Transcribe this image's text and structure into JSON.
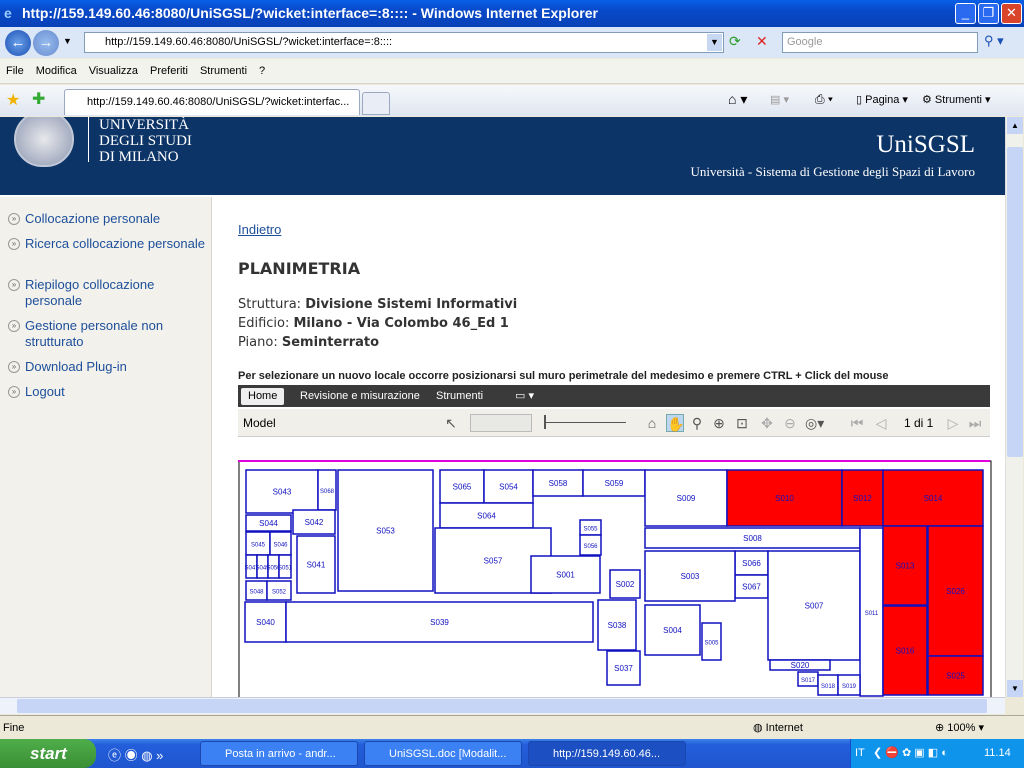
{
  "window": {
    "title": "http://159.149.60.46:8080/UniSGSL/?wicket:interface=:8:::: - Windows Internet Explorer"
  },
  "browser": {
    "address": "http://159.149.60.46:8080/UniSGSL/?wicket:interface=:8::::",
    "search_placeholder": "Google",
    "menu": [
      "File",
      "Modifica",
      "Visualizza",
      "Preferiti",
      "Strumenti",
      "?"
    ],
    "tab_title": "http://159.149.60.46:8080/UniSGSL/?wicket:interfac...",
    "cmd_pagina": "Pagina",
    "cmd_strumenti": "Strumenti",
    "status": "Fine",
    "zone": "Internet",
    "zoom": "100%"
  },
  "banner": {
    "uni_line1": "UNIVERSITÀ",
    "uni_line2": "DEGLI STUDI",
    "uni_line3": "DI MILANO",
    "app_name": "UniSGSL",
    "app_subtitle": "Università - Sistema di Gestione degli Spazi di Lavoro",
    "bg_color": "#0d3466"
  },
  "sidebar": {
    "items": [
      {
        "label": "Collocazione personale"
      },
      {
        "label": "Ricerca collocazione personale"
      },
      {
        "label": "Riepilogo collocazione personale"
      },
      {
        "label": "Gestione personale non strutturato"
      },
      {
        "label": "Download Plug-in"
      },
      {
        "label": "Logout"
      }
    ]
  },
  "main": {
    "back_link": "Indietro",
    "title": "PLANIMETRIA",
    "struttura_label": "Struttura:",
    "struttura_value": "Divisione Sistemi Informativi",
    "edificio_label": "Edificio:",
    "edificio_value": "Milano - Via Colombo 46_Ed 1",
    "piano_label": "Piano:",
    "piano_value": "Seminterrato",
    "instruction": "Per selezionare un nuovo locale occorre posizionarsi sul muro perimetrale del medesimo e premere CTRL + Click del mouse"
  },
  "viewer": {
    "tabs": [
      "Home",
      "Revisione e misurazione",
      "Strumenti"
    ],
    "model_label": "Model",
    "page_indicator": "1 di 1",
    "highlight_color": "#ff0000",
    "rooms": [
      {
        "label": "S043",
        "selected": false
      },
      {
        "label": "S068",
        "selected": false
      },
      {
        "label": "S053",
        "selected": false
      },
      {
        "label": "S065",
        "selected": false
      },
      {
        "label": "S054",
        "selected": false
      },
      {
        "label": "S058",
        "selected": false
      },
      {
        "label": "S059",
        "selected": false
      },
      {
        "label": "S064",
        "selected": false
      },
      {
        "label": "S044",
        "selected": false
      },
      {
        "label": "S042",
        "selected": false
      },
      {
        "label": "S045",
        "selected": false
      },
      {
        "label": "S046",
        "selected": false
      },
      {
        "label": "S047",
        "selected": false
      },
      {
        "label": "S049",
        "selected": false
      },
      {
        "label": "S050",
        "selected": false
      },
      {
        "label": "S051",
        "selected": false
      },
      {
        "label": "S048",
        "selected": false
      },
      {
        "label": "S052",
        "selected": false
      },
      {
        "label": "S041",
        "selected": false
      },
      {
        "label": "S057",
        "selected": false
      },
      {
        "label": "S001",
        "selected": false
      },
      {
        "label": "S055",
        "selected": false
      },
      {
        "label": "S056",
        "selected": false
      },
      {
        "label": "S040",
        "selected": false
      },
      {
        "label": "S039",
        "selected": false
      },
      {
        "label": "S038",
        "selected": false
      },
      {
        "label": "S009",
        "selected": false
      },
      {
        "label": "S010",
        "selected": true
      },
      {
        "label": "S012",
        "selected": true
      },
      {
        "label": "S014",
        "selected": true
      },
      {
        "label": "S008",
        "selected": false
      },
      {
        "label": "S066",
        "selected": false
      },
      {
        "label": "S067",
        "selected": false
      },
      {
        "label": "S007",
        "selected": false
      },
      {
        "label": "S003",
        "selected": false
      },
      {
        "label": "S002",
        "selected": false
      },
      {
        "label": "S004",
        "selected": false
      },
      {
        "label": "S005",
        "selected": false
      },
      {
        "label": "S037",
        "selected": false
      },
      {
        "label": "S020",
        "selected": false
      },
      {
        "label": "S011",
        "selected": false
      },
      {
        "label": "S013",
        "selected": true
      },
      {
        "label": "S026",
        "selected": true
      },
      {
        "label": "S016",
        "selected": true
      },
      {
        "label": "S025",
        "selected": true
      },
      {
        "label": "S017",
        "selected": false
      },
      {
        "label": "S018",
        "selected": false
      },
      {
        "label": "S019",
        "selected": false
      }
    ]
  },
  "taskbar": {
    "start": "start",
    "tasks": [
      "Posta in arrivo - andr...",
      "UniSGSL.doc [Modalit...",
      "http://159.149.60.46..."
    ],
    "lang": "IT",
    "clock": "11.14"
  }
}
